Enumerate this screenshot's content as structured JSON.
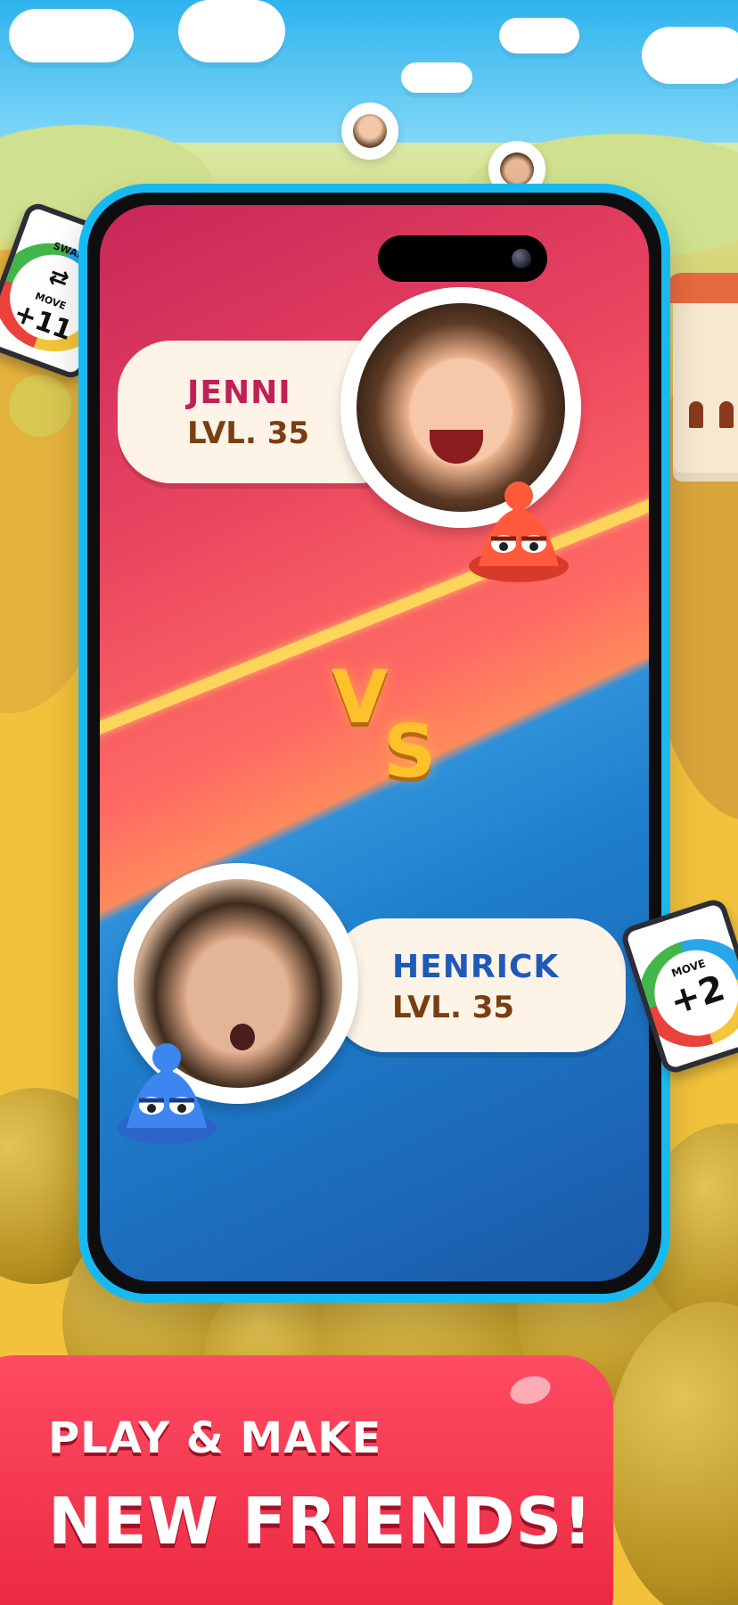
{
  "players": [
    {
      "name": "JENNI",
      "level": "LVL. 35",
      "color": "#c01f57"
    },
    {
      "name": "HENRICK",
      "level": "LVL. 35",
      "color": "#1e5ab8"
    }
  ],
  "versus": {
    "v": "V",
    "s": "S"
  },
  "cards": [
    {
      "top": "SWAP",
      "bottom": "MOVE",
      "value": "+11"
    },
    {
      "top": "MOVE",
      "value": "+2"
    }
  ],
  "headline": {
    "line1": "PLAY & MAKE",
    "line2": "NEW FRIENDS!"
  },
  "colors": {
    "top_half": "#e8425f",
    "bottom_half": "#1e7ecc",
    "banner": "#ff4b63",
    "phone_frame": "#18b9f0"
  }
}
